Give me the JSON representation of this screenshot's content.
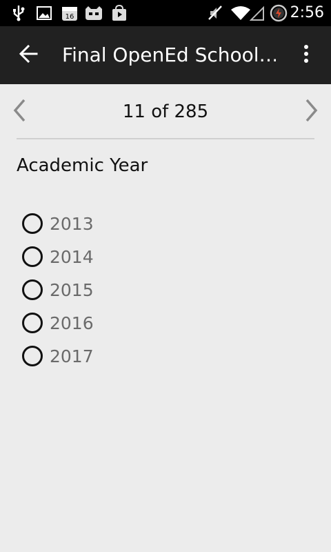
{
  "status_bar": {
    "time": "2:56",
    "icons": [
      "usb-icon",
      "image-icon",
      "calendar-icon",
      "cyanogen-icon",
      "play-store-icon",
      "mute-icon",
      "wifi-icon",
      "signal-icon",
      "battery-charging-icon"
    ]
  },
  "app_bar": {
    "title": "Final OpenEd School…",
    "back_icon": "arrow-back-icon",
    "menu_icon": "overflow-menu-icon"
  },
  "pager": {
    "counter": "11 of 285"
  },
  "question": {
    "label": "Academic Year"
  },
  "options": [
    {
      "label": "2013",
      "selected": false
    },
    {
      "label": "2014",
      "selected": false
    },
    {
      "label": "2015",
      "selected": false
    },
    {
      "label": "2016",
      "selected": false
    },
    {
      "label": "2017",
      "selected": false
    }
  ]
}
